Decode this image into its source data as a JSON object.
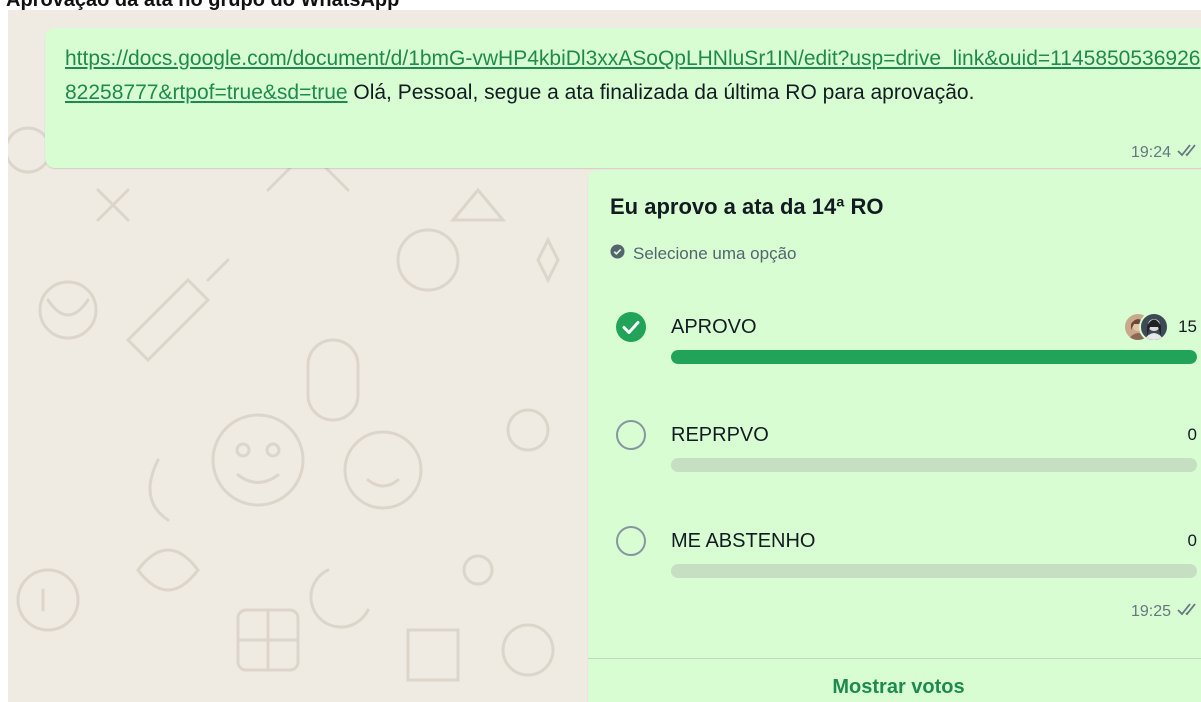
{
  "header": {
    "caption": "Aprovação da ata no grupo do WhatsApp"
  },
  "message": {
    "link": "https://docs.google.com/document/d/1bmG-vwHP4kbiDl3xxASoQpLHNluSr1IN/edit?usp=drive_link&ouid=114585053692682258777&rtpof=true&sd=true",
    "text": " Olá, Pessoal, segue a ata finalizada da última RO para aprovação.",
    "time": "19:24",
    "status_icon": "double-check-icon"
  },
  "poll": {
    "question": "Eu aprovo a ata da 14ª RO",
    "instruction": "Selecione uma opção",
    "options": [
      {
        "label": "APROVO",
        "votes": "15",
        "selected": true,
        "fraction": 1.0
      },
      {
        "label": "REPRPVO",
        "votes": "0",
        "selected": false,
        "fraction": 0
      },
      {
        "label": "ME ABSTENHO",
        "votes": "0",
        "selected": false,
        "fraction": 0
      }
    ],
    "time": "19:25",
    "status_icon": "double-check-icon",
    "show_votes_label": "Mostrar votos"
  },
  "colors": {
    "chat_background": "#efeae2",
    "bubble_outgoing": "#d9fdd3",
    "accent_green": "#21a35a",
    "link_green": "#1f8a4d"
  }
}
